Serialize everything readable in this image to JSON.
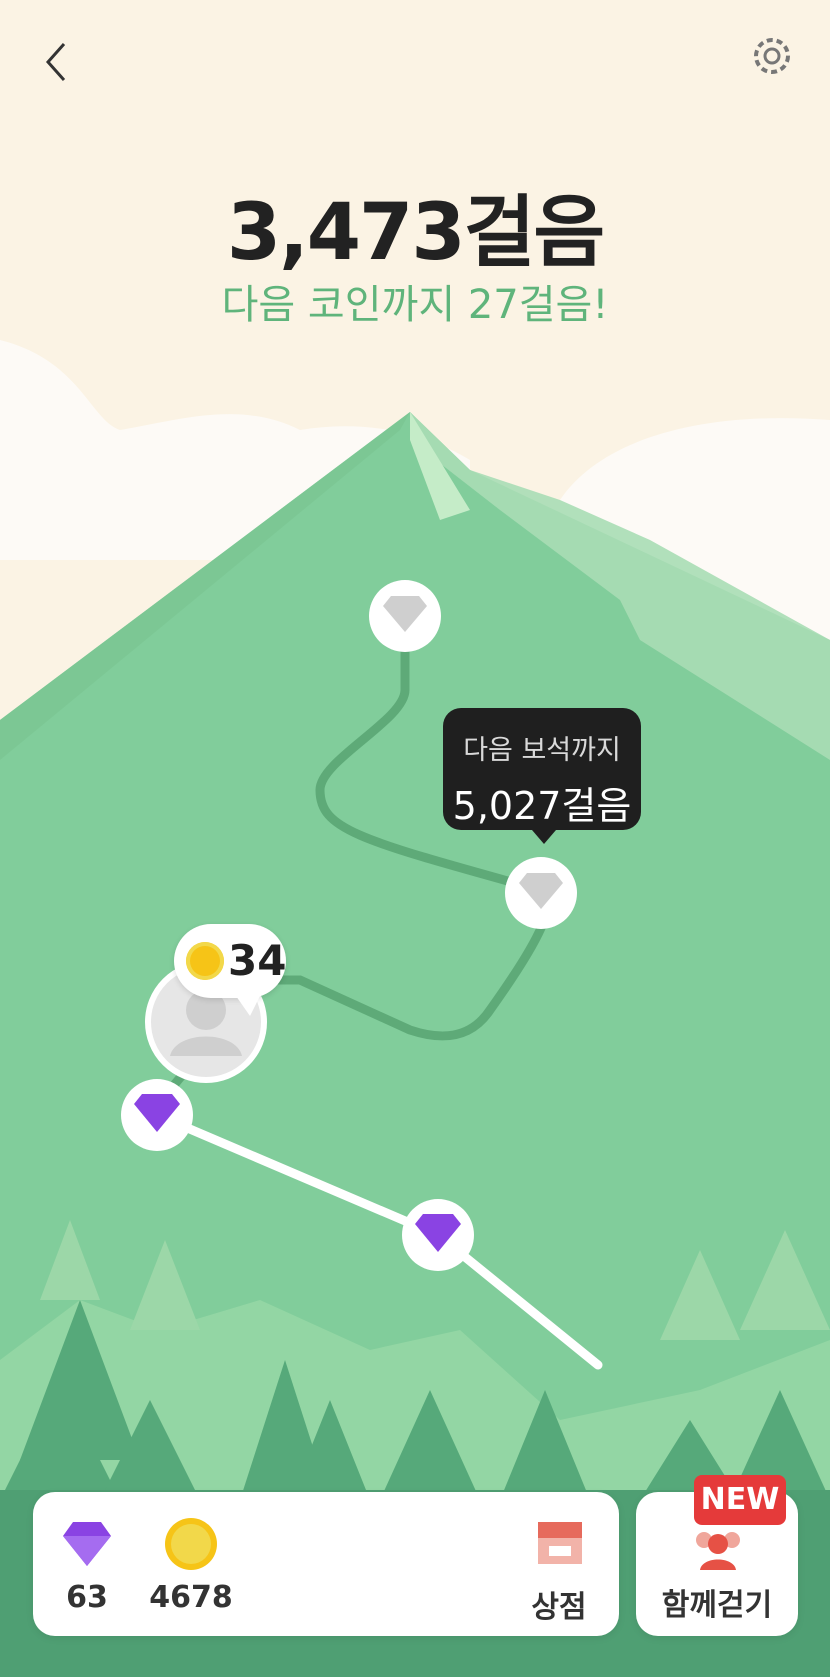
{
  "header": {
    "steps_count": "3,473걸음",
    "next_coin_text": "다음 코인까지 27걸음!"
  },
  "map": {
    "tooltip_line1": "다음 보석까지",
    "tooltip_line2": "5,027걸음",
    "coin_bubble_count": "34"
  },
  "bottom": {
    "gem_count": "63",
    "coin_count": "4678",
    "shop_label": "상점",
    "walk_together_label": "함께걷기",
    "new_badge": "NEW"
  },
  "icons": [
    "back-icon",
    "gear-icon",
    "gem-icon",
    "coin-icon",
    "shop-icon",
    "group-walk-icon",
    "avatar-icon"
  ],
  "colors": {
    "accent_green": "#5fb47b",
    "mountain": "#7fcd9a",
    "gem_purple": "#8a43e3",
    "badge_red": "#e53a3a"
  }
}
